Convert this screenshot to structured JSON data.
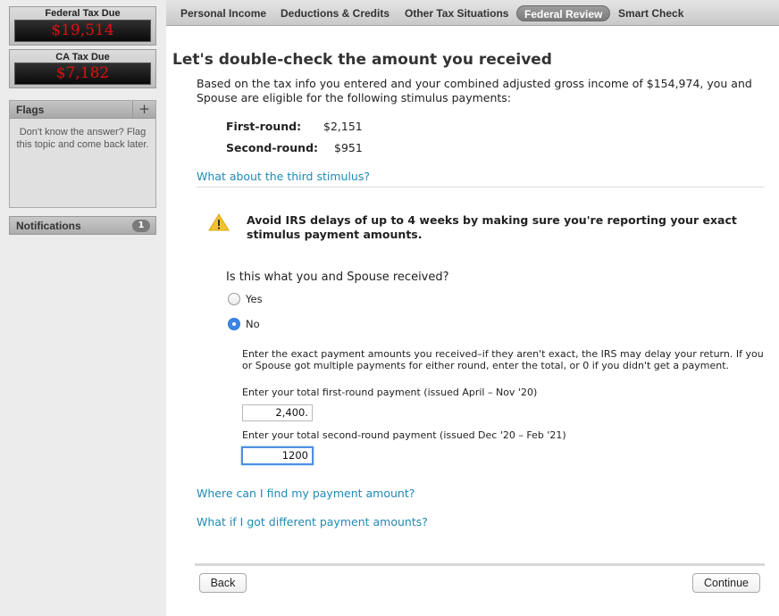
{
  "sidebar": {
    "federal": {
      "label": "Federal Tax Due",
      "value": "$19,514"
    },
    "ca": {
      "label": "CA Tax Due",
      "value": "$7,182"
    },
    "flags": {
      "title": "Flags",
      "add_symbol": "+",
      "text": "Don't know the answer? Flag this topic and come back later."
    },
    "notifications": {
      "title": "Notifications",
      "count": "1"
    }
  },
  "nav": {
    "tabs": [
      {
        "label": "Personal Income"
      },
      {
        "label": "Deductions & Credits"
      },
      {
        "label": "Other Tax Situations"
      },
      {
        "label": "Federal Review"
      },
      {
        "label": "Smart Check"
      }
    ],
    "active_tab": "Federal Review"
  },
  "main": {
    "title": "Let's double-check the amount you received",
    "intro": "Based on the tax info you entered and your combined adjusted gross income of $154,974, you and Spouse are eligible for the following stimulus payments:",
    "first_round": {
      "label": "First-round:",
      "value": "$2,151"
    },
    "second_round": {
      "label": "Second-round:",
      "value": "$951"
    },
    "third_link": "What about the third stimulus?",
    "warning": "Avoid IRS delays of up to 4 weeks by making sure you're reporting your exact stimulus payment amounts.",
    "question": "Is this what you and Spouse received?",
    "options": [
      {
        "label": "Yes",
        "selected": false
      },
      {
        "label": "No",
        "selected": true
      }
    ],
    "instructions": "Enter the exact payment amounts you received–if they aren't exact, the IRS may delay your return. If you or Spouse got multiple payments for either round, enter the total, or 0 if you didn't get a payment.",
    "first_field": {
      "label": "Enter your total first-round payment (issued April – Nov '20)",
      "value": "2,400."
    },
    "second_field": {
      "label": "Enter your total second-round payment (issued Dec '20 – Feb '21)",
      "value": "1200"
    },
    "link_find": "Where can I find my payment amount?",
    "link_different": "What if I got different payment amounts?",
    "back_label": "Back",
    "continue_label": "Continue"
  },
  "colors": {
    "accent_link": "#1f8ab5",
    "tax_due_red": "#e01010",
    "warning_yellow": "#f2c230",
    "radio_blue": "#3b86e8"
  }
}
